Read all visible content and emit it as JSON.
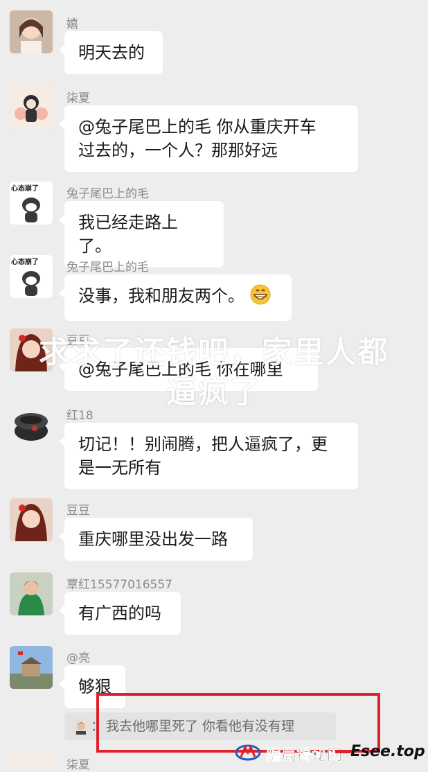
{
  "messages": [
    {
      "name": "嬉",
      "lines": [
        "明天去的"
      ]
    },
    {
      "name": "柒夏",
      "lines": [
        "@兔子尾巴上的毛  你从重庆开车",
        "过去的，一个人？那那好远"
      ]
    },
    {
      "name": "兔子尾巴上的毛",
      "avatar_text": "心态崩了",
      "lines": [
        "我已经走路上了。"
      ]
    },
    {
      "name": "兔子尾巴上的毛",
      "avatar_text": "心态崩了",
      "lines": [
        "没事，我和朋友两个。"
      ],
      "emoji": "grin-icon"
    },
    {
      "name": "豆豆",
      "lines": [
        "@兔子尾巴上的毛  你在哪里"
      ]
    },
    {
      "name": "红18",
      "lines": [
        "切记！！别闹腾，把人逼疯了，更",
        "是一无所有"
      ]
    },
    {
      "name": "豆豆",
      "lines": [
        "重庆哪里没出发一路"
      ]
    },
    {
      "name": "覃红15577016557",
      "lines": [
        "有广西的吗"
      ]
    },
    {
      "name": "@亮",
      "lines": [
        "够狠"
      ]
    },
    {
      "name": "柒夏",
      "lines": []
    }
  ],
  "quote": {
    "colon": "：",
    "text": "我去他哪里死了  你看他有没有理"
  },
  "overlay": {
    "line1": "求求了还钱吧，家里人都",
    "line2": "逼疯了"
  },
  "watermark": {
    "text": "骗局揭秘网",
    "site": "Esee.top"
  },
  "colors": {
    "bg": "#ededed",
    "bubble": "#ffffff",
    "highlight": "#e0212b"
  }
}
